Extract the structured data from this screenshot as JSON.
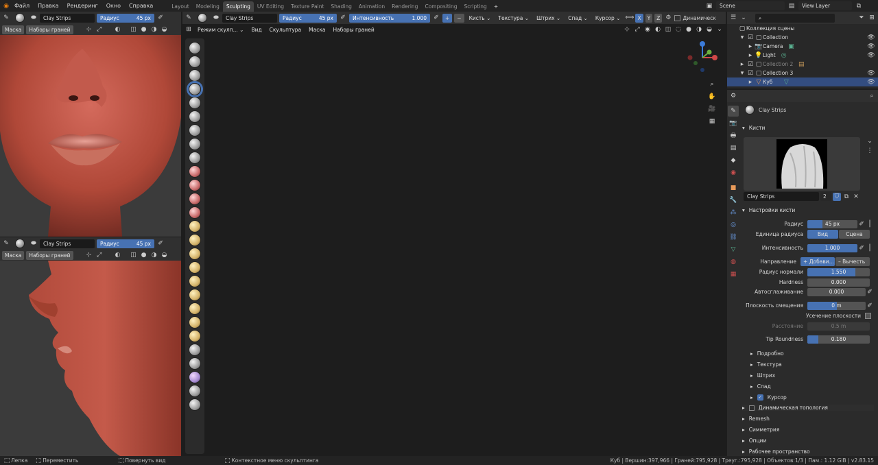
{
  "menu": {
    "items": [
      "Файл",
      "Правка",
      "Рендеринг",
      "Окно",
      "Справка"
    ]
  },
  "workspaces": [
    "Layout",
    "Modeling",
    "Sculpting",
    "UV Editing",
    "Texture Paint",
    "Shading",
    "Animation",
    "Rendering",
    "Compositing",
    "Scripting"
  ],
  "active_workspace": "Sculpting",
  "scene": {
    "name": "Scene",
    "view_layer": "View Layer"
  },
  "brush": {
    "name": "Clay Strips",
    "radius_label": "Радиус",
    "radius_value": "45 px",
    "strength_label": "Интенсивность",
    "strength_value": "1.000"
  },
  "header_menus": {
    "brush": "Кисть",
    "texture": "Текстура",
    "stroke": "Штрих",
    "falloff": "Спад",
    "cursor": "Курсор",
    "axes": [
      "X",
      "Y",
      "Z"
    ],
    "dyntopo": "Динамическ"
  },
  "viewport_menus": {
    "mode": "Режим скулп...",
    "view": "Вид",
    "sculpt": "Скульптура",
    "mask": "Маска",
    "face_sets": "Наборы граней"
  },
  "left_menus": {
    "mask": "Маска",
    "face_sets": "Наборы граней"
  },
  "outliner": {
    "search_placeholder": "",
    "root": "Коллекция сцены",
    "rows": [
      {
        "label": "Collection"
      },
      {
        "label": "Camera"
      },
      {
        "label": "Light"
      },
      {
        "label": "Collection 2"
      },
      {
        "label": "Collection 3"
      },
      {
        "label": "Куб"
      }
    ]
  },
  "properties": {
    "brush_name": "Clay Strips",
    "section_brushes": "Кисти",
    "brush_field": "Clay Strips",
    "brush_users": "2",
    "section_settings": "Настройки кисти",
    "rows": {
      "radius": {
        "label": "Радиус",
        "value": "45 px",
        "fill": 0.3
      },
      "radius_unit": {
        "label": "Единица радиуса",
        "opt1": "Вид",
        "opt2": "Сцена"
      },
      "strength": {
        "label": "Интенсивность",
        "value": "1.000",
        "fill": 1.0
      },
      "direction": {
        "label": "Направление",
        "add": "+ Добави...",
        "sub": "– Вычесть"
      },
      "normal_radius": {
        "label": "Радиус нормали",
        "value": "1.550",
        "fill": 0.77
      },
      "hardness": {
        "label": "Hardness",
        "value": "0.000",
        "fill": 0
      },
      "autosmooth": {
        "label": "Автосглаживание",
        "value": "0.000",
        "fill": 0
      },
      "plane_offset": {
        "label": "Плоскость смещения",
        "value": "0 m",
        "fill": 0.5
      },
      "plane_trim": {
        "label": "Усечение плоскости"
      },
      "distance": {
        "label": "Расстояние",
        "value": "0.5 m"
      },
      "tip_roundness": {
        "label": "Tip Roundness",
        "value": "0.180",
        "fill": 0.18
      }
    },
    "subsections": [
      "Подробно",
      "Текстура",
      "Штрих",
      "Спад",
      "Курсор"
    ],
    "panels": [
      "Динамическая топология",
      "Remesh",
      "Симметрия",
      "Опции",
      "Рабочее пространство"
    ]
  },
  "status": {
    "left1": "Лепка",
    "left2": "Переместить",
    "left3": "Повернуть вид",
    "center": "Контекстное меню скульптинга",
    "right": "Куб | Вершин:397,966 | Граней:795,928 | Треуг.:795,928 | Объектов:1/3 | Пам.: 1.12 GiB | v2.83.15"
  },
  "colors": {
    "accent": "#4772b3",
    "skin": "#b5483c",
    "bg": "#3b3b3b"
  }
}
